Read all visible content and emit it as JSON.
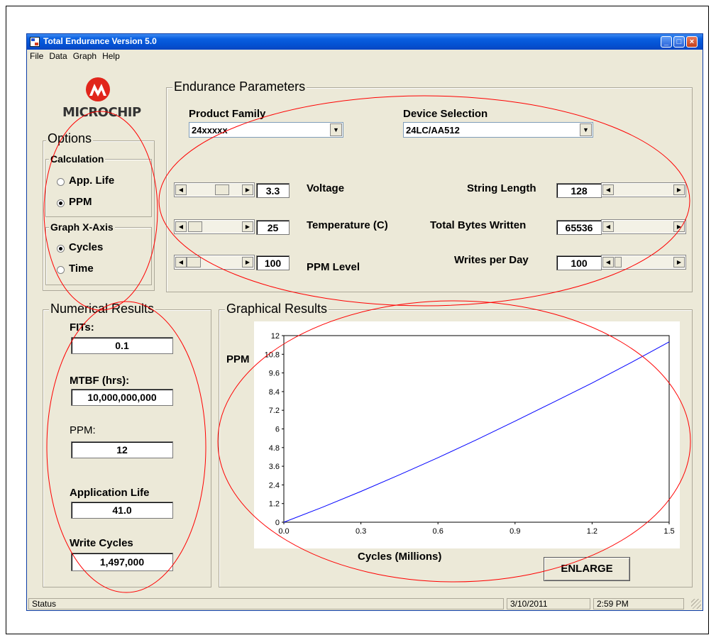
{
  "window": {
    "title": "Total Endurance Version 5.0"
  },
  "menu": [
    "File",
    "Data",
    "Graph",
    "Help"
  ],
  "logo": {
    "text": "MICROCHIP"
  },
  "options": {
    "title": "Options",
    "calculation": {
      "title": "Calculation",
      "items": [
        "App. Life",
        "PPM"
      ],
      "selected": "PPM"
    },
    "graph_x_axis": {
      "title": "Graph X-Axis",
      "items": [
        "Cycles",
        "Time"
      ],
      "selected": "Cycles"
    }
  },
  "endurance": {
    "title": "Endurance Parameters",
    "product_family": {
      "label": "Product Family",
      "value": "24xxxxx"
    },
    "device_selection": {
      "label": "Device Selection",
      "value": "24LC/AA512"
    },
    "voltage": {
      "label": "Voltage",
      "value": "3.3"
    },
    "temperature": {
      "label": "Temperature (C)",
      "value": "25"
    },
    "ppm_level": {
      "label": "PPM Level",
      "value": "100"
    },
    "string_length": {
      "label": "String Length",
      "value": "128"
    },
    "total_bytes": {
      "label": "Total Bytes Written",
      "value": "65536"
    },
    "writes_per_day": {
      "label": "Writes per Day",
      "value": "100"
    }
  },
  "numerical": {
    "title": "Numerical Results",
    "fits": {
      "label": "FITs:",
      "value": "0.1"
    },
    "mtbf": {
      "label": "MTBF (hrs):",
      "value": "10,000,000,000"
    },
    "ppm": {
      "label": "PPM:",
      "value": "12"
    },
    "app_life": {
      "label": "Application Life",
      "value": "41.0"
    },
    "write_cycles": {
      "label": "Write Cycles",
      "value": "1,497,000"
    }
  },
  "graphical": {
    "title": "Graphical Results",
    "enlarge_label": "ENLARGE"
  },
  "chart_data": {
    "type": "line",
    "xlabel": "Cycles (Millions)",
    "ylabel": "PPM",
    "xlim": [
      0,
      1.5
    ],
    "ylim": [
      0,
      12
    ],
    "xticks": [
      "0.0",
      "0.3",
      "0.6",
      "0.9",
      "1.2",
      "1.5"
    ],
    "yticks": [
      "0",
      "1.2",
      "2.4",
      "3.6",
      "4.8",
      "6",
      "7.2",
      "8.4",
      "9.6",
      "10.8",
      "12"
    ],
    "line_color": "#0000ff",
    "series": [
      {
        "x": [
          0,
          0.15,
          0.3,
          0.45,
          0.6,
          0.75,
          0.9,
          1.05,
          1.2,
          1.35,
          1.5
        ],
        "y": [
          0,
          0.96,
          1.98,
          3.05,
          4.15,
          5.3,
          6.5,
          7.72,
          8.95,
          10.25,
          11.6
        ]
      }
    ]
  },
  "status": {
    "text": "Status",
    "date": "3/10/2011",
    "time": "2:59 PM"
  },
  "colors": {
    "annotation": "#ff0000",
    "title_bar": "#0a5fe0",
    "window_bg": "#ece9d8"
  }
}
